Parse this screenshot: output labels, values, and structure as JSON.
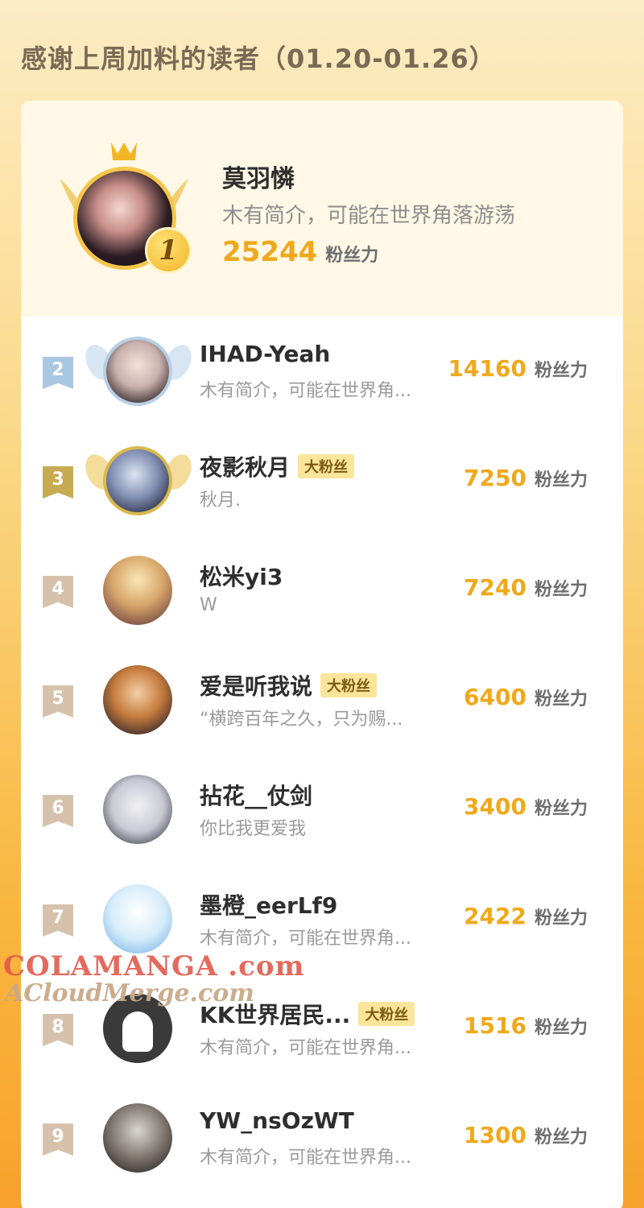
{
  "header": {
    "title": "感谢上周加料的读者（01.20-01.26）"
  },
  "top": {
    "rank": "1",
    "name": "莫羽憐",
    "bio": "木有简介，可能在世界角落游荡",
    "score": "25244",
    "unit": "粉丝力"
  },
  "list": [
    {
      "rank": "2",
      "name": "IHAD-Yeah",
      "badge": "",
      "bio": "木有简介，可能在世界角...",
      "score": "14160",
      "unit": "粉丝力"
    },
    {
      "rank": "3",
      "name": "夜影秋月",
      "badge": "大粉丝",
      "bio": "秋月.",
      "score": "7250",
      "unit": "粉丝力"
    },
    {
      "rank": "4",
      "name": "松米yi3",
      "badge": "",
      "bio": "W",
      "score": "7240",
      "unit": "粉丝力"
    },
    {
      "rank": "5",
      "name": "爱是听我说",
      "badge": "大粉丝",
      "bio": "“横跨百年之久，只为赐...",
      "score": "6400",
      "unit": "粉丝力"
    },
    {
      "rank": "6",
      "name": "拈花__仗剑",
      "badge": "",
      "bio": "你比我更爱我",
      "score": "3400",
      "unit": "粉丝力"
    },
    {
      "rank": "7",
      "name": "墨橙_eerLf9",
      "badge": "",
      "bio": "木有简介，可能在世界角...",
      "score": "2422",
      "unit": "粉丝力"
    },
    {
      "rank": "8",
      "name": "KK世界居民...",
      "badge": "大粉丝",
      "bio": "木有简介，可能在世界角...",
      "score": "1516",
      "unit": "粉丝力"
    },
    {
      "rank": "9",
      "name": "YW_nsOzWT",
      "badge": "",
      "bio": "木有简介，可能在世界角...",
      "score": "1300",
      "unit": "粉丝力"
    }
  ],
  "watermark": {
    "line1": "COLAMANGA .com",
    "line2": "ACloudMerge.com"
  },
  "colors": {
    "accent": "#f0a81b",
    "background_top": "#fcecc4",
    "background_bottom": "#f7a22b"
  }
}
